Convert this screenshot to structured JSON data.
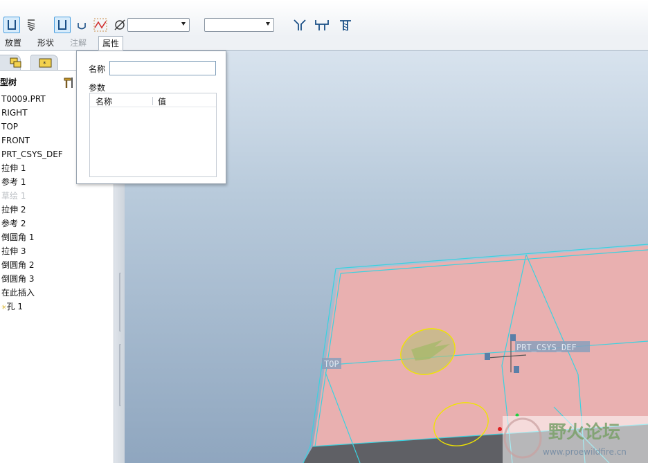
{
  "toolbar": {
    "buttons": [
      {
        "name": "remove-material-icon",
        "active": true
      },
      {
        "name": "rotate-icon",
        "active": false
      },
      {
        "name": "simple-hole-icon",
        "active": true
      },
      {
        "name": "counterbore-icon",
        "active": false
      },
      {
        "name": "sketch-profile-icon",
        "active": false
      },
      {
        "name": "diameter-icon",
        "active": false
      },
      {
        "name": "countersink-icon",
        "active": false
      },
      {
        "name": "thread-icon",
        "active": false
      },
      {
        "name": "tapped-hole-icon",
        "active": false
      }
    ],
    "diameter_value": "",
    "depth_value": ""
  },
  "tabs": [
    {
      "label": "放置",
      "state": "normal"
    },
    {
      "label": "形状",
      "state": "normal"
    },
    {
      "label": "注解",
      "state": "disabled"
    },
    {
      "label": "属性",
      "state": "selected"
    }
  ],
  "tree": {
    "header": "型树",
    "items": [
      {
        "label": "T0009.PRT"
      },
      {
        "label": "RIGHT"
      },
      {
        "label": "TOP"
      },
      {
        "label": "FRONT"
      },
      {
        "label": "PRT_CSYS_DEF"
      },
      {
        "label": "拉伸 1"
      },
      {
        "label": "参考 1"
      },
      {
        "label": "草绘 1",
        "suppressed": true
      },
      {
        "label": "拉伸 2"
      },
      {
        "label": "参考 2"
      },
      {
        "label": "倒圆角 1"
      },
      {
        "label": "拉伸 3"
      },
      {
        "label": "倒圆角 2"
      },
      {
        "label": "倒圆角 3"
      },
      {
        "label": "在此插入"
      },
      {
        "label": "孔 1"
      }
    ]
  },
  "properties_panel": {
    "name_label": "名称",
    "name_value": "",
    "params_label": "参数",
    "col_name": "名称",
    "col_value": "值"
  },
  "viewport": {
    "datum_top": "TOP",
    "csys_label": "PRT_CSYS_DEF",
    "watermark_cn": "野火论坛",
    "watermark_url": "www.proewildfire.cn",
    "colors": {
      "top_face": "#e9b0b0",
      "edges": "#3ad2e0",
      "highlight": "#f0e400"
    }
  }
}
